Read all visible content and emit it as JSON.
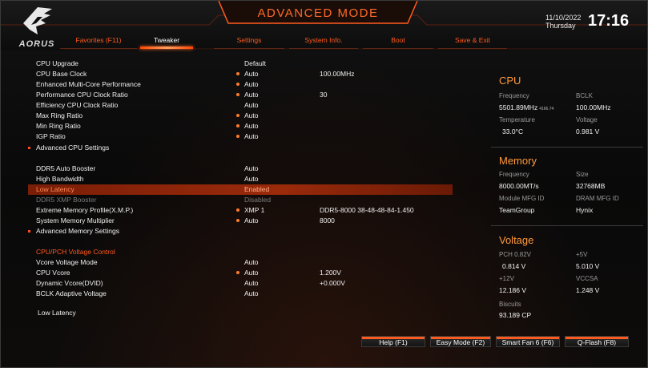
{
  "header": {
    "logo_text": "AORUS",
    "mode_title": "ADVANCED MODE",
    "date": "11/10/2022",
    "weekday": "Thursday",
    "time": "17:16",
    "accent_color": "#ff5a1f"
  },
  "tabs": [
    {
      "label": "Favorites (F11)",
      "active": false
    },
    {
      "label": "Tweaker",
      "active": true
    },
    {
      "label": "Settings",
      "active": false
    },
    {
      "label": "System Info.",
      "active": false
    },
    {
      "label": "Boot",
      "active": false
    },
    {
      "label": "Save & Exit",
      "active": false
    }
  ],
  "settings": [
    {
      "label": "CPU Upgrade",
      "value": "Default",
      "value2": "",
      "dot": false
    },
    {
      "label": "CPU Base Clock",
      "value": "Auto",
      "value2": "100.00MHz",
      "dot": true
    },
    {
      "label": "Enhanced Multi-Core Performance",
      "value": "Auto",
      "value2": "",
      "dot": true
    },
    {
      "label": "Performance CPU Clock Ratio",
      "value": "Auto",
      "value2": "30",
      "dot": true
    },
    {
      "label": "Efficiency CPU Clock Ratio",
      "value": "Auto",
      "value2": "",
      "dot": false
    },
    {
      "label": "Max Ring Ratio",
      "value": "Auto",
      "value2": "",
      "dot": true
    },
    {
      "label": "Min Ring Ratio",
      "value": "Auto",
      "value2": "",
      "dot": true
    },
    {
      "label": "IGP Ratio",
      "value": "Auto",
      "value2": "",
      "dot": true
    },
    {
      "label": "Advanced CPU Settings",
      "value": "",
      "value2": "",
      "dot": false,
      "submenu": true
    },
    {
      "label": "DDR5 Auto Booster",
      "value": "Auto",
      "value2": "",
      "dot": false
    },
    {
      "label": "High Bandwidth",
      "value": "Auto",
      "value2": "",
      "dot": false
    },
    {
      "label": "Low Latency",
      "value": "Enabled",
      "value2": "",
      "dot": false,
      "selected": true
    },
    {
      "label": "DDR5 XMP Booster",
      "value": "Disabled",
      "value2": "",
      "dot": false,
      "disabled": true
    },
    {
      "label": "Extreme Memory Profile(X.M.P.)",
      "value": "XMP 1",
      "value2": "DDR5-8000 38-48-48-84-1.450",
      "dot": true
    },
    {
      "label": "System Memory Multiplier",
      "value": "Auto",
      "value2": "8000",
      "dot": true
    },
    {
      "label": "Advanced Memory Settings",
      "value": "",
      "value2": "",
      "dot": false,
      "submenu": true
    },
    {
      "label": "CPU/PCH Voltage Control",
      "value": "",
      "value2": "",
      "dot": false,
      "section": true
    },
    {
      "label": "Vcore Voltage Mode",
      "value": "Auto",
      "value2": "",
      "dot": false
    },
    {
      "label": "CPU Vcore",
      "value": "Auto",
      "value2": "1.200V",
      "dot": true
    },
    {
      "label": "Dynamic Vcore(DVID)",
      "value": "Auto",
      "value2": "+0.000V",
      "dot": false
    },
    {
      "label": "BCLK Adaptive Voltage",
      "value": "Auto",
      "value2": "",
      "dot": false
    }
  ],
  "help_text": "Low Latency",
  "info": {
    "cpu": {
      "title": "CPU",
      "frequency_label": "Frequency",
      "frequency_value": "5501.89MHz",
      "frequency_sub": "4166.74",
      "bclk_label": "BCLK",
      "bclk_value": "100.00MHz",
      "temperature_label": "Temperature",
      "temperature_value": "33.0°C",
      "voltage_label": "Voltage",
      "voltage_value": "0.981 V"
    },
    "memory": {
      "title": "Memory",
      "frequency_label": "Frequency",
      "frequency_value": "8000.00MT/s",
      "size_label": "Size",
      "size_value": "32768MB",
      "module_label": "Module MFG ID",
      "module_value": "TeamGroup",
      "dram_label": "DRAM MFG ID",
      "dram_value": "Hynix"
    },
    "voltage": {
      "title": "Voltage",
      "pch_label": "PCH 0.82V",
      "pch_value": "0.814 V",
      "p5v_label": "+5V",
      "p5v_value": "5.010 V",
      "p12v_label": "+12V",
      "p12v_value": "12.186 V",
      "vccsa_label": "VCCSA",
      "vccsa_value": "1.248 V",
      "biscuits_label": "Biscuits",
      "biscuits_value": "93.189 CP"
    }
  },
  "footer": {
    "help": "Help (F1)",
    "easy_mode": "Easy Mode (F2)",
    "smart_fan": "Smart Fan 6 (F6)",
    "qflash": "Q-Flash (F8)"
  }
}
